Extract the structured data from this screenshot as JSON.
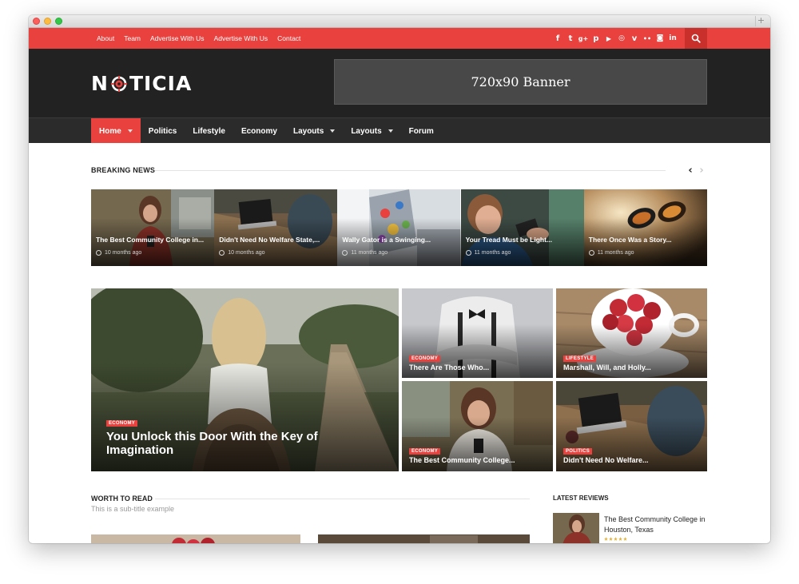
{
  "browser": {
    "new_tab_symbol": "+"
  },
  "topbar": {
    "links": [
      "About",
      "Team",
      "Advertise With Us",
      "Advertise With Us",
      "Contact"
    ],
    "social_icons": [
      {
        "name": "facebook-icon",
        "glyph": "f"
      },
      {
        "name": "twitter-icon",
        "glyph": "t"
      },
      {
        "name": "google-plus-icon",
        "glyph": "g+"
      },
      {
        "name": "pinterest-icon",
        "glyph": "p"
      },
      {
        "name": "youtube-icon",
        "glyph": "▶"
      },
      {
        "name": "dribbble-icon",
        "glyph": "◎"
      },
      {
        "name": "vimeo-icon",
        "glyph": "v"
      },
      {
        "name": "flickr-icon",
        "glyph": "••"
      },
      {
        "name": "instagram-icon",
        "glyph": "◙"
      },
      {
        "name": "linkedin-icon",
        "glyph": "in"
      }
    ],
    "accent_color": "#e8413e"
  },
  "header": {
    "logo_left": "N",
    "logo_right": "TICIA",
    "banner_text": "720x90 Banner"
  },
  "nav": {
    "items": [
      {
        "label": "Home",
        "active": true,
        "dropdown": true
      },
      {
        "label": "Politics",
        "active": false,
        "dropdown": false
      },
      {
        "label": "Lifestyle",
        "active": false,
        "dropdown": false
      },
      {
        "label": "Economy",
        "active": false,
        "dropdown": false
      },
      {
        "label": "Layouts",
        "active": false,
        "dropdown": true
      },
      {
        "label": "Layouts",
        "active": false,
        "dropdown": true
      },
      {
        "label": "Forum",
        "active": false,
        "dropdown": false
      }
    ]
  },
  "breaking": {
    "label": "BREAKING NEWS",
    "prev_arrow": "‹",
    "next_arrow": "›",
    "items": [
      {
        "title": "The Best Community College in...",
        "time": "10 months ago"
      },
      {
        "title": "Didn't Need No Welfare State,...",
        "time": "10 months ago"
      },
      {
        "title": "Wally Gator is a Swinging...",
        "time": "11 months ago"
      },
      {
        "title": "Your Tread Must be Light...",
        "time": "11 months ago"
      },
      {
        "title": "There Once Was a Story...",
        "time": "11 months ago"
      }
    ]
  },
  "featured": {
    "main": {
      "category": "ECONOMY",
      "title": "You Unlock this Door With the Key of Imagination"
    },
    "tiles": [
      {
        "category": "ECONOMY",
        "title": "There Are Those Who..."
      },
      {
        "category": "LIFESTYLE",
        "title": "Marshall, Will, and Holly..."
      },
      {
        "category": "ECONOMY",
        "title": "The Best Community College..."
      },
      {
        "category": "POLITICS",
        "title": "Didn't Need No Welfare..."
      }
    ]
  },
  "worth": {
    "label": "WORTH TO READ",
    "subtitle": "This is a sub-title example"
  },
  "reviews": {
    "label": "LATEST REVIEWS",
    "item": {
      "title": "The Best Community College in Houston, Texas",
      "stars": 5
    }
  }
}
